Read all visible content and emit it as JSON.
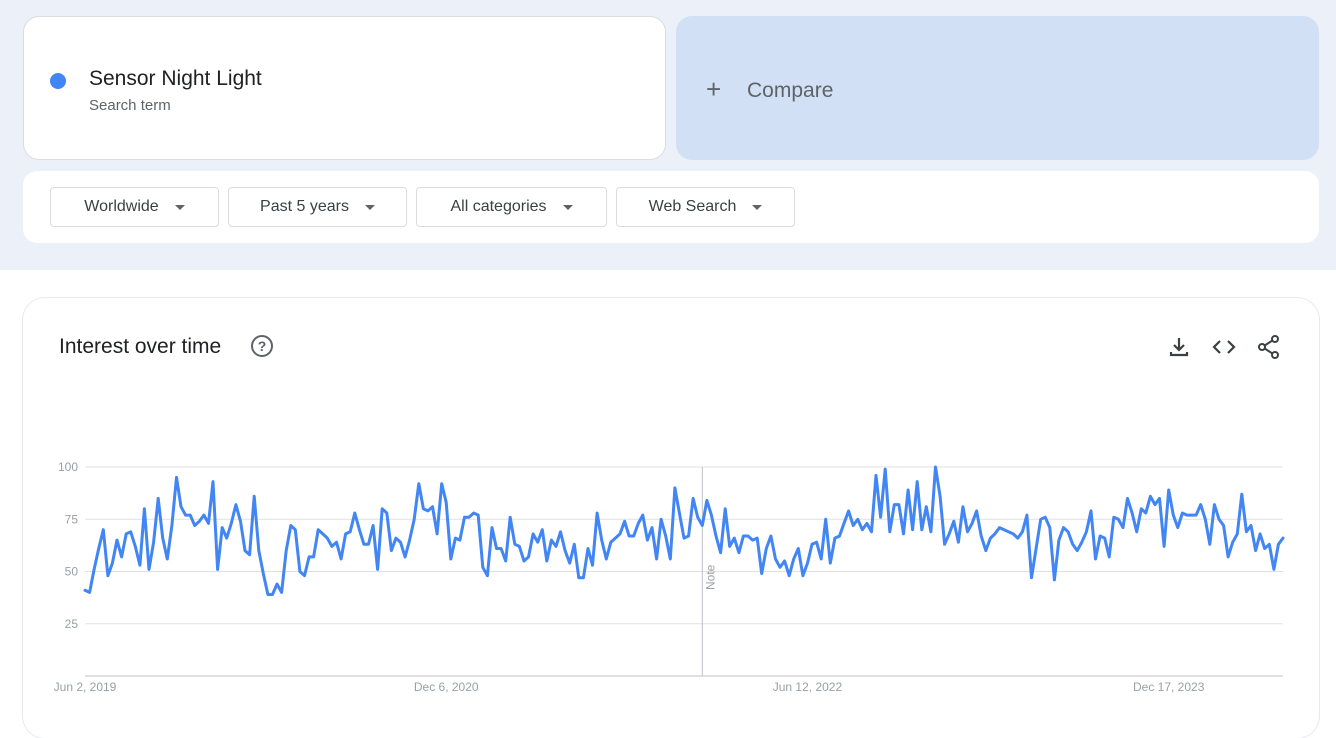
{
  "search_term": {
    "name": "Sensor Night Light",
    "sub": "Search term",
    "dot_color": "#4285f4"
  },
  "compare": {
    "plus": "+",
    "label": "Compare"
  },
  "filters": [
    {
      "label": "Worldwide"
    },
    {
      "label": "Past 5 years"
    },
    {
      "label": "All categories"
    },
    {
      "label": "Web Search"
    }
  ],
  "chart": {
    "title": "Interest over time",
    "help_icon": "help-circle-icon",
    "tools": [
      "download-icon",
      "embed-code-icon",
      "share-icon"
    ],
    "note_label": "Note"
  },
  "chart_data": {
    "type": "line",
    "color": "#4285f4",
    "y_ticks": [
      100,
      75,
      50,
      25
    ],
    "ylim": [
      0,
      100
    ],
    "x_tick_labels": [
      "Jun 2, 2019",
      "Dec 6, 2020",
      "Jun 12, 2022",
      "Dec 17, 2023"
    ],
    "note_week_index": 135,
    "series": [
      {
        "values": [
          41,
          40,
          51,
          61,
          70,
          48,
          54,
          65,
          57,
          68,
          69,
          62,
          53,
          80,
          51,
          64,
          85,
          66,
          56,
          72,
          95,
          81,
          77,
          77,
          72,
          74,
          77,
          73,
          93,
          51,
          71,
          66,
          73,
          82,
          74,
          60,
          58,
          86,
          60,
          49,
          39,
          39,
          44,
          40,
          60,
          72,
          70,
          50,
          48,
          57,
          57,
          70,
          68,
          66,
          62,
          64,
          56,
          68,
          69,
          78,
          70,
          63,
          63,
          72,
          51,
          80,
          78,
          60,
          66,
          64,
          57,
          65,
          75,
          92,
          80,
          79,
          81,
          68,
          92,
          83,
          56,
          66,
          65,
          76,
          76,
          78,
          77,
          52,
          48,
          71,
          61,
          61,
          55,
          76,
          63,
          62,
          55,
          57,
          68,
          64,
          70,
          55,
          65,
          62,
          69,
          60,
          54,
          63,
          47,
          47,
          61,
          53,
          78,
          65,
          56,
          64,
          66,
          68,
          74,
          67,
          67,
          73,
          77,
          65,
          71,
          56,
          75,
          67,
          56,
          90,
          78,
          66,
          67,
          85,
          76,
          72,
          84,
          77,
          67,
          59,
          80,
          62,
          66,
          59,
          67,
          67,
          65,
          66,
          49,
          61,
          67,
          56,
          52,
          55,
          48,
          56,
          61,
          48,
          54,
          63,
          64,
          56,
          75,
          54,
          66,
          67,
          73,
          79,
          72,
          75,
          70,
          73,
          69,
          96,
          76,
          99,
          69,
          82,
          82,
          68,
          89,
          70,
          93,
          70,
          81,
          69,
          100,
          86,
          63,
          68,
          74,
          64,
          81,
          69,
          73,
          79,
          67,
          60,
          66,
          68,
          71,
          70,
          69,
          68,
          66,
          69,
          77,
          47,
          61,
          75,
          76,
          71,
          46,
          65,
          71,
          69,
          63,
          60,
          64,
          69,
          79,
          56,
          67,
          66,
          57,
          76,
          75,
          71,
          85,
          78,
          69,
          80,
          78,
          86,
          82,
          85,
          62,
          89,
          77,
          71,
          78,
          77,
          77,
          77,
          82,
          75,
          63,
          82,
          75,
          72,
          57,
          64,
          68,
          87,
          69,
          72,
          60,
          68,
          61,
          63,
          51,
          63,
          66
        ]
      }
    ]
  }
}
